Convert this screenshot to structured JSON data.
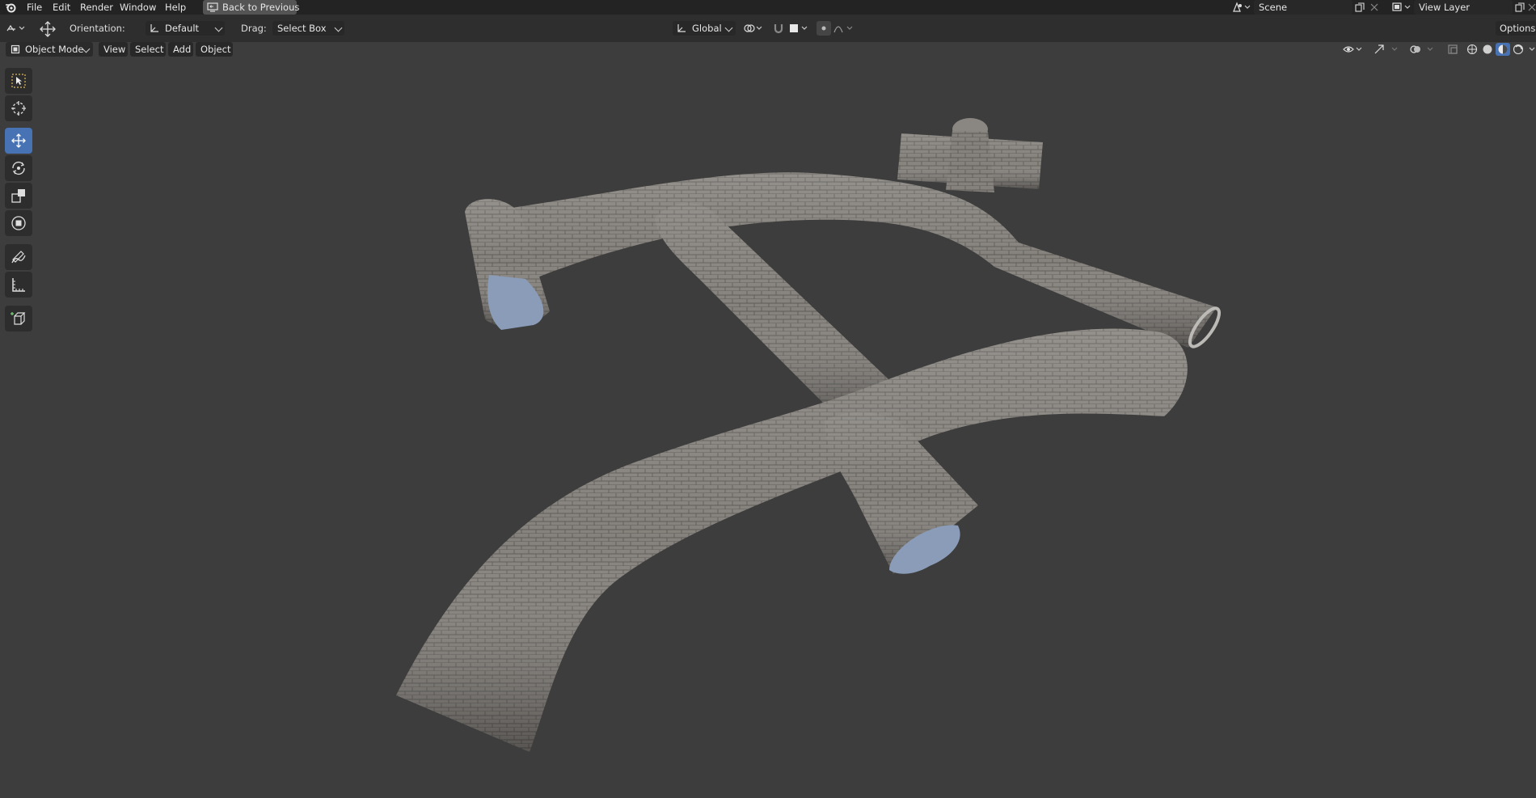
{
  "menu": {
    "items": [
      "File",
      "Edit",
      "Render",
      "Window",
      "Help"
    ],
    "back_button": "Back to Previous"
  },
  "scene": {
    "name": "Scene"
  },
  "view_layer": {
    "name": "View Layer"
  },
  "toolbar": {
    "orientation_label": "Orientation:",
    "orientation_value": "Default",
    "drag_label": "Drag:",
    "drag_value": "Select Box",
    "transform_space": "Global",
    "options_label": "Options"
  },
  "header": {
    "mode": "Object Mode",
    "items": [
      "View",
      "Select",
      "Add",
      "Object"
    ]
  },
  "tools": [
    {
      "name": "select-box-icon"
    },
    {
      "name": "cursor-icon"
    },
    {
      "name": "move-icon",
      "active": true
    },
    {
      "name": "rotate-icon"
    },
    {
      "name": "scale-icon"
    },
    {
      "name": "transform-icon"
    },
    {
      "name": "annotate-icon"
    },
    {
      "name": "measure-icon"
    },
    {
      "name": "add-cube-icon"
    }
  ],
  "colors": {
    "viewport_bg": "#3d3d3d",
    "active_tool": "#4772b3",
    "pipe_stone": "#7f7c78"
  }
}
